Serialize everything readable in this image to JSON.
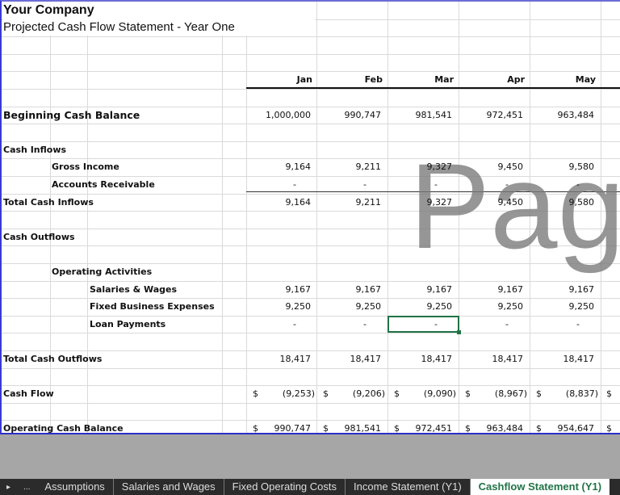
{
  "sheet": {
    "company": "Your Company",
    "subtitle": "Projected Cash Flow Statement - Year One",
    "months": [
      "Jan",
      "Feb",
      "Mar",
      "Apr",
      "May"
    ],
    "watermark": "Page",
    "rows": [
      {
        "row": 6,
        "label": "Beginning Cash Balance",
        "indent": 0,
        "bold": true,
        "big": true,
        "values": [
          "1,000,000",
          "990,747",
          "981,541",
          "972,451",
          "963,484"
        ]
      },
      {
        "row": 8,
        "label": "Cash Inflows",
        "indent": 0,
        "bold": true,
        "values": []
      },
      {
        "row": 9,
        "label": "Gross Income",
        "indent": 1,
        "bold": true,
        "values": [
          "9,164",
          "9,211",
          "9,327",
          "9,450",
          "9,580"
        ]
      },
      {
        "row": 10,
        "label": "Accounts Receivable",
        "indent": 1,
        "bold": true,
        "values": [
          "-",
          "-",
          "-",
          "-",
          "-"
        ]
      },
      {
        "row": 11,
        "label": "Total Cash Inflows",
        "indent": 0,
        "bold": true,
        "values": [
          "9,164",
          "9,211",
          "9,327",
          "9,450",
          "9,580"
        ]
      },
      {
        "row": 13,
        "label": "Cash Outflows",
        "indent": 0,
        "bold": true,
        "values": []
      },
      {
        "row": 15,
        "label": "Operating Activities",
        "indent": 1,
        "bold": true,
        "values": []
      },
      {
        "row": 16,
        "label": "Salaries & Wages",
        "indent": 2,
        "bold": true,
        "values": [
          "9,167",
          "9,167",
          "9,167",
          "9,167",
          "9,167"
        ]
      },
      {
        "row": 17,
        "label": "Fixed Business Expenses",
        "indent": 2,
        "bold": true,
        "values": [
          "9,250",
          "9,250",
          "9,250",
          "9,250",
          "9,250"
        ]
      },
      {
        "row": 18,
        "label": "Loan Payments",
        "indent": 2,
        "bold": true,
        "values": [
          "-",
          "-",
          "-",
          "-",
          "-"
        ]
      },
      {
        "row": 20,
        "label": "Total Cash Outflows",
        "indent": 0,
        "bold": true,
        "values": [
          "18,417",
          "18,417",
          "18,417",
          "18,417",
          "18,417"
        ]
      },
      {
        "row": 22,
        "label": "Cash Flow",
        "indent": 0,
        "bold": true,
        "currency": true,
        "values": [
          "(9,253)",
          "(9,206)",
          "(9,090)",
          "(8,967)",
          "(8,837)"
        ]
      },
      {
        "row": 24,
        "label": "Operating Cash Balance",
        "indent": 0,
        "bold": true,
        "currency": true,
        "values": [
          "990,747",
          "981,541",
          "972,451",
          "963,484",
          "954,647"
        ]
      }
    ],
    "currency_symbol": "$"
  },
  "tabs": {
    "nav_prev": "▸",
    "more": "...",
    "items": [
      "Assumptions",
      "Salaries and Wages",
      "Fixed Operating Costs",
      "Income Statement (Y1)",
      "Cashflow Statement (Y1)"
    ],
    "active": 4
  },
  "colors": {
    "accent": "#217346",
    "gridline": "#dadada",
    "selection_border": "#217346"
  }
}
